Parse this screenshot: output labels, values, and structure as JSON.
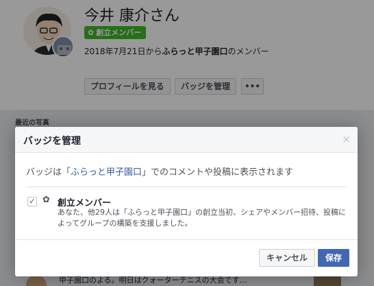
{
  "profile": {
    "name": "今井 康介さん",
    "badge": "創立メンバー",
    "member_since_prefix": "2018年7月21日から",
    "group_name": "ふらっと甲子園口",
    "member_since_suffix": "のメンバー",
    "buttons": {
      "view_profile": "プロフィールを見る",
      "manage_badges": "バッジを管理",
      "more": "•••"
    }
  },
  "background": {
    "recent_photos_label": "最近の写真",
    "post_snippet": "甲子園口のよる。明日はクォーターテニスの大会です…"
  },
  "dialog": {
    "title": "バッジを管理",
    "close": "×",
    "desc_prefix": "バッジは「",
    "desc_group": "ふらっと甲子園口",
    "desc_suffix": "」でのコメントや投稿に表示されます",
    "badge_name": "創立メンバー",
    "badge_checked": true,
    "badge_description": "あなた、他29人は「ふらっと甲子園口」の創立当初、シェアやメンバー招待、投稿によってグループの構築を支援しました。",
    "cancel_label": "キャンセル",
    "save_label": "保存"
  },
  "colors": {
    "badge_green": "#42b72a",
    "link_blue": "#365899",
    "primary_button": "#4267b2"
  },
  "icons": {
    "badge": "sprout-icon",
    "checkbox": "checkmark-icon",
    "close": "close-icon"
  }
}
